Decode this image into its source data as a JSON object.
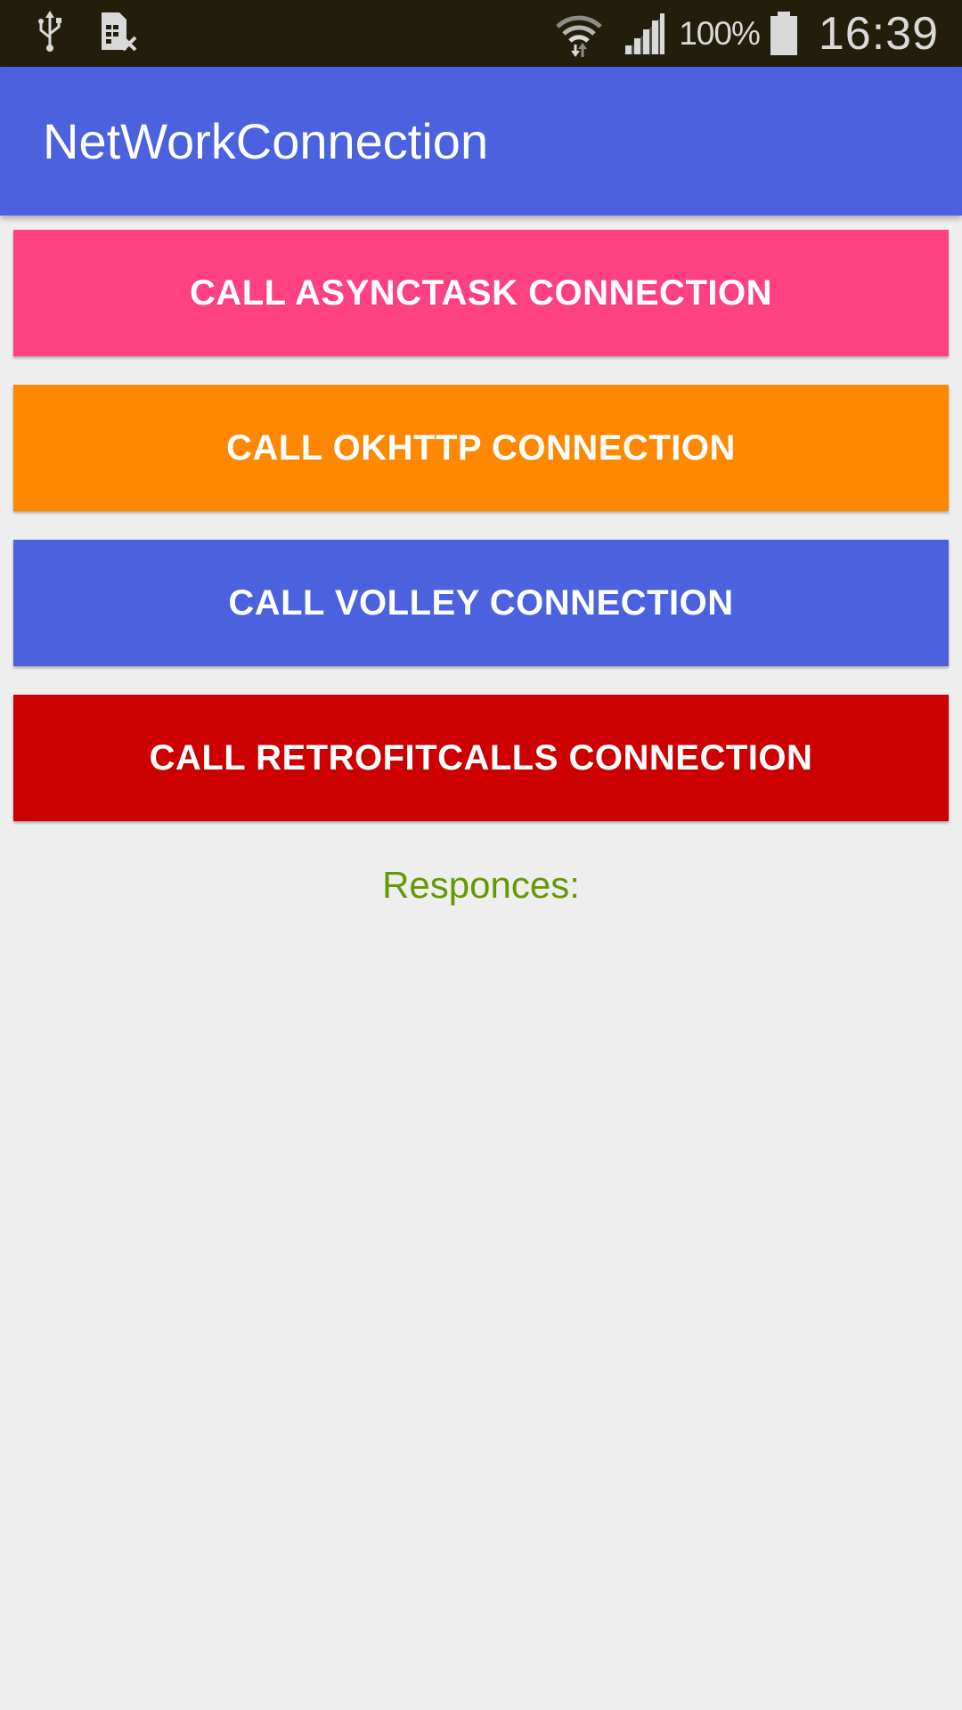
{
  "status_bar": {
    "battery_percent": "100%",
    "time": "16:39",
    "icons": [
      "usb-icon",
      "sim-card-missing-icon",
      "wifi-icon",
      "cell-signal-icon",
      "battery-icon"
    ]
  },
  "app_bar": {
    "title": "NetWorkConnection",
    "color": "#4b61dd"
  },
  "buttons": [
    {
      "label": "CALL ASYNCTASK CONNECTION",
      "color": "#ff4081"
    },
    {
      "label": "CALL OKHTTP CONNECTION",
      "color": "#ff8800"
    },
    {
      "label": "CALL VOLLEY CONNECTION",
      "color": "#4b61dd"
    },
    {
      "label": "CALL RETROFITCALLS CONNECTION",
      "color": "#cc0000"
    }
  ],
  "responses": {
    "label": "Responces:",
    "color": "#669900"
  }
}
